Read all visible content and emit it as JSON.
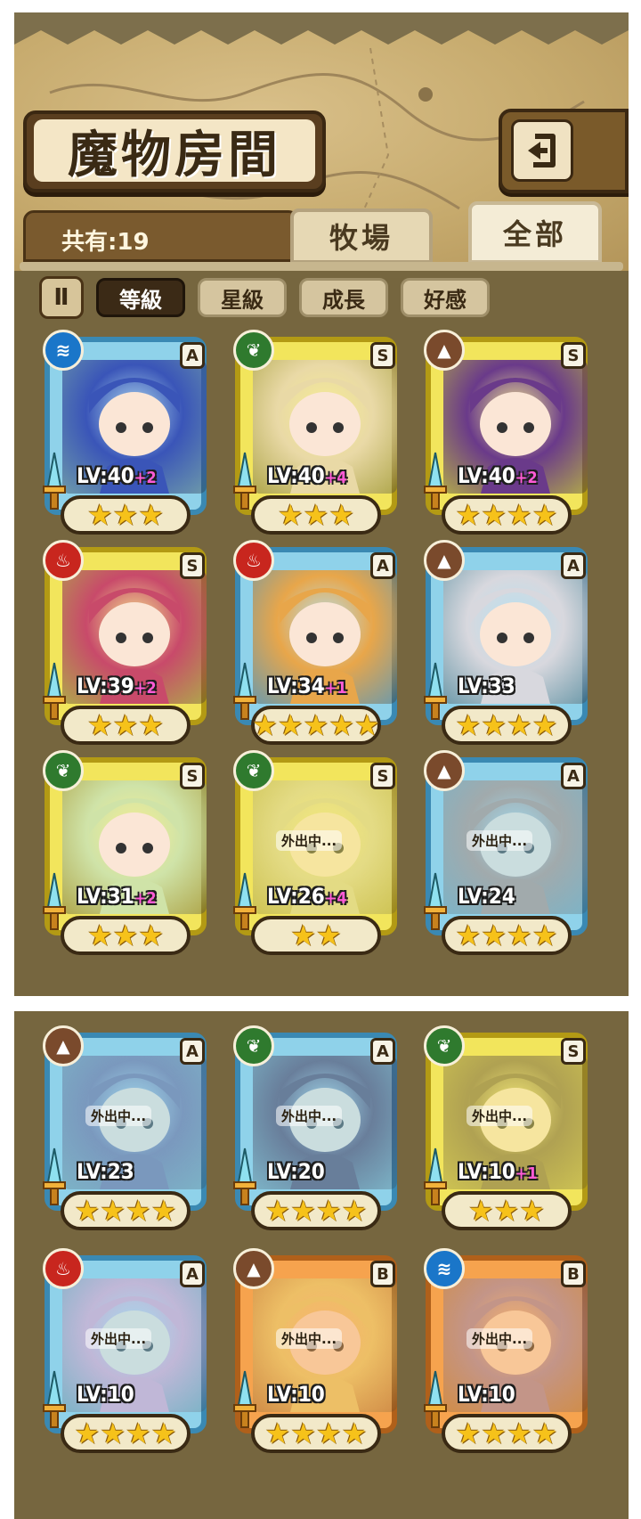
{
  "header": {
    "title": "魔物房間",
    "back_icon": "return-arrow-icon"
  },
  "tabs": {
    "count_label": "共有:19",
    "ranch_label": "牧場",
    "all_label": "全部"
  },
  "sort": {
    "toggle_label": "Ⅱ",
    "buttons": [
      "等級",
      "星級",
      "成長",
      "好感"
    ],
    "active": "等級"
  },
  "monsters_top": [
    {
      "rank": "A",
      "element": "water",
      "level": "LV:40",
      "plus": "+2",
      "stars": "★★★",
      "frame": "A",
      "away": "",
      "art": "#3a55b8"
    },
    {
      "rank": "S",
      "element": "wood",
      "level": "LV:40",
      "plus": "+4",
      "stars": "★★★",
      "frame": "S",
      "away": "",
      "art": "#e9d9a6"
    },
    {
      "rank": "S",
      "element": "earth",
      "level": "LV:40",
      "plus": "+2",
      "stars": "★★★★",
      "frame": "S",
      "away": "",
      "art": "#6a3a8a"
    },
    {
      "rank": "S",
      "element": "fire",
      "level": "LV:39",
      "plus": "+2",
      "stars": "★★★",
      "frame": "S",
      "away": "",
      "art": "#c84a6a"
    },
    {
      "rank": "A",
      "element": "fire",
      "level": "LV:34",
      "plus": "+1",
      "stars": "★★★★★",
      "frame": "A",
      "away": "",
      "art": "#e8a64a"
    },
    {
      "rank": "A",
      "element": "earth",
      "level": "LV:33",
      "plus": "",
      "stars": "★★★★",
      "frame": "A",
      "away": "",
      "art": "#d8d8de"
    },
    {
      "rank": "S",
      "element": "wood",
      "level": "LV:31",
      "plus": "+2",
      "stars": "★★★",
      "frame": "S",
      "away": "",
      "art": "#cfe3a8"
    },
    {
      "rank": "S",
      "element": "wood",
      "level": "LV:26",
      "plus": "+4",
      "stars": "★★",
      "frame": "S",
      "away": "外出中...",
      "art": "#d8d3a6"
    },
    {
      "rank": "A",
      "element": "earth",
      "level": "LV:24",
      "plus": "",
      "stars": "★★★★",
      "frame": "A",
      "away": "外出中...",
      "art": "#b08a7a"
    }
  ],
  "monsters_bottom": [
    {
      "rank": "A",
      "element": "earth",
      "level": "LV:23",
      "plus": "",
      "stars": "★★★★",
      "frame": "A",
      "away": "外出中...",
      "art": "#6a6a9a"
    },
    {
      "rank": "A",
      "element": "wood",
      "level": "LV:20",
      "plus": "",
      "stars": "★★★★",
      "frame": "A",
      "away": "外出中...",
      "art": "#4a3a5a"
    },
    {
      "rank": "S",
      "element": "wood",
      "level": "LV:10",
      "plus": "+1",
      "stars": "★★★",
      "frame": "S",
      "away": "外出中...",
      "art": "#7a6a4a"
    },
    {
      "rank": "A",
      "element": "fire",
      "level": "LV:10",
      "plus": "",
      "stars": "★★★★",
      "frame": "A",
      "away": "外出中...",
      "art": "#e8a2c8"
    },
    {
      "rank": "B",
      "element": "earth",
      "level": "LV:10",
      "plus": "",
      "stars": "★★★★",
      "frame": "B",
      "away": "外出中...",
      "art": "#e6d67a"
    },
    {
      "rank": "B",
      "element": "water",
      "level": "LV:10",
      "plus": "",
      "stars": "★★★★",
      "frame": "B",
      "away": "外出中...",
      "art": "#9a8ab8"
    }
  ],
  "element_icons": {
    "water": "waves-icon",
    "wood": "leaf-icon",
    "earth": "mountain-icon",
    "fire": "flame-icon"
  }
}
